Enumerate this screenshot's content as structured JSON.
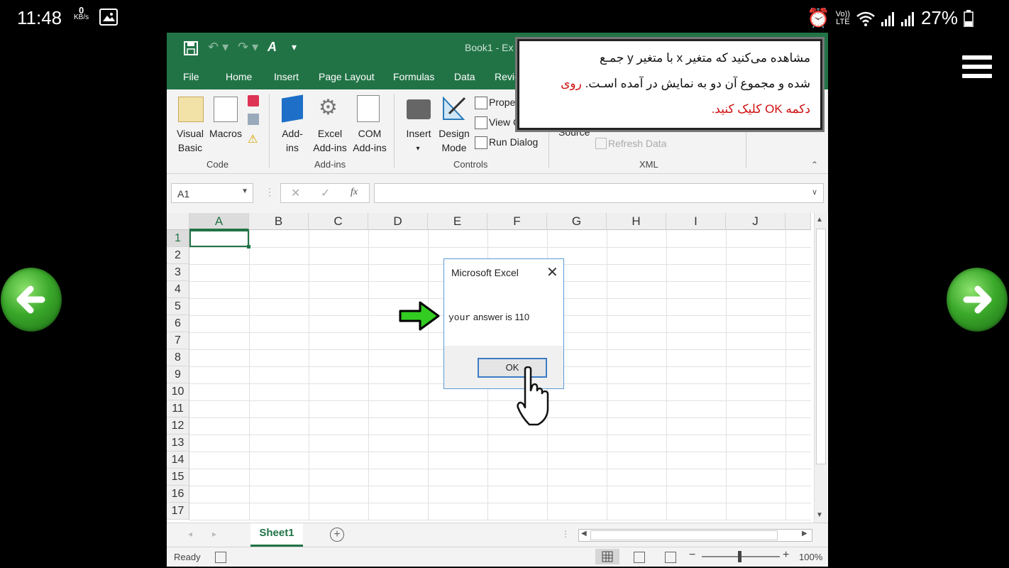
{
  "status": {
    "time": "11:48",
    "net_speed": "0",
    "net_unit": "KB/s",
    "battery": "27%",
    "volte_top": "Vo))",
    "volte_bottom": "LTE"
  },
  "excel": {
    "title": "Book1 - Ex",
    "tabs": [
      "File",
      "Home",
      "Insert",
      "Page Layout",
      "Formulas",
      "Data",
      "Revie"
    ],
    "ribbon": {
      "visual_basic": "Visual Basic",
      "macros": "Macros",
      "addins": "Add- ins",
      "excel_addins": "Excel Add-ins",
      "com_addins": "COM Add-ins",
      "insert": "Insert",
      "design_mode": "Design Mode",
      "properties": "Proper",
      "view_code": "View C",
      "run_dialog": "Run Dialog",
      "source": "Source",
      "refresh_data": "Refresh Data",
      "groups": [
        "Code",
        "Add-ins",
        "Controls",
        "XML"
      ]
    },
    "name_box": "A1",
    "fx": "fx",
    "columns": [
      "A",
      "B",
      "C",
      "D",
      "E",
      "F",
      "G",
      "H",
      "I",
      "J"
    ],
    "rows": [
      "1",
      "2",
      "3",
      "4",
      "5",
      "6",
      "7",
      "8",
      "9",
      "10",
      "11",
      "12",
      "13",
      "14",
      "15",
      "16",
      "17"
    ],
    "sheet_tab": "Sheet1",
    "status_ready": "Ready",
    "zoom": "100%"
  },
  "dialog": {
    "title": "Microsoft Excel",
    "message_mono": "your",
    "message_rest": "answer is 110",
    "ok_label": "OK"
  },
  "note": {
    "line1": "مشاهده می‌کنید که متغیر x با متغیر y جمـع",
    "line2": "شده و مجموع آن دو به نمایش در آمده اسـت.",
    "line2_red": "روی",
    "line3_red": "دکمه OK کلیک کنید."
  },
  "colors": {
    "excel_green": "#217346",
    "arrow_green": "#33cc22",
    "note_red": "#d01010"
  }
}
